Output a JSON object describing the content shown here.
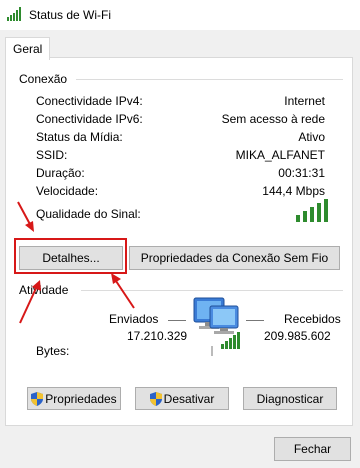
{
  "window": {
    "title": "Status de Wi-Fi"
  },
  "tabs": [
    {
      "label": "Geral"
    }
  ],
  "connection": {
    "group_title": "Conexão",
    "rows": [
      {
        "label": "Conectividade IPv4:",
        "value": "Internet"
      },
      {
        "label": "Conectividade IPv6:",
        "value": "Sem acesso à rede"
      },
      {
        "label": "Status da Mídia:",
        "value": "Ativo"
      },
      {
        "label": "SSID:",
        "value": "MIKA_ALFANET"
      },
      {
        "label": "Duração:",
        "value": "00:31:31"
      },
      {
        "label": "Velocidade:",
        "value": "144,4 Mbps"
      }
    ],
    "signal_label": "Qualidade do Sinal:",
    "signal_bars_filled": 5,
    "signal_bars_total": 5
  },
  "buttons": {
    "details": "Detalhes...",
    "wireless_properties": "Propriedades da Conexão Sem Fio"
  },
  "activity": {
    "group_title": "Atividade",
    "sent_label": "Enviados",
    "received_label": "Recebidos",
    "sent_value": "17.210.329",
    "received_value": "209.985.602",
    "bytes_label": "Bytes:"
  },
  "actions": {
    "properties": "Propriedades",
    "disable": "Desativar",
    "diagnose": "Diagnosticar"
  },
  "footer": {
    "close": "Fechar"
  },
  "colors": {
    "annotation_red": "#d71818",
    "signal_green": "#2e8b2e"
  }
}
